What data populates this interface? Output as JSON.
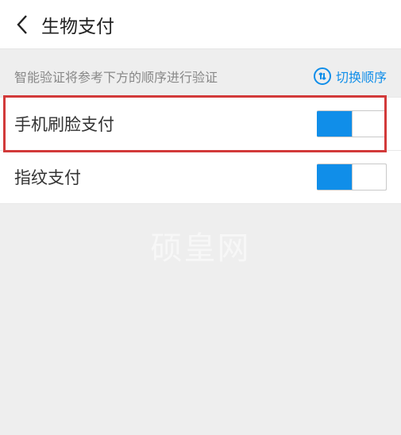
{
  "header": {
    "title": "生物支付"
  },
  "hint": {
    "text": "智能验证将参考下方的顺序进行验证",
    "switch_label": "切换顺序"
  },
  "settings": [
    {
      "label": "手机刷脸支付",
      "on": true
    },
    {
      "label": "指纹支付",
      "on": true
    }
  ],
  "watermark": {
    "line1": "硕皇网",
    "line2": ""
  }
}
